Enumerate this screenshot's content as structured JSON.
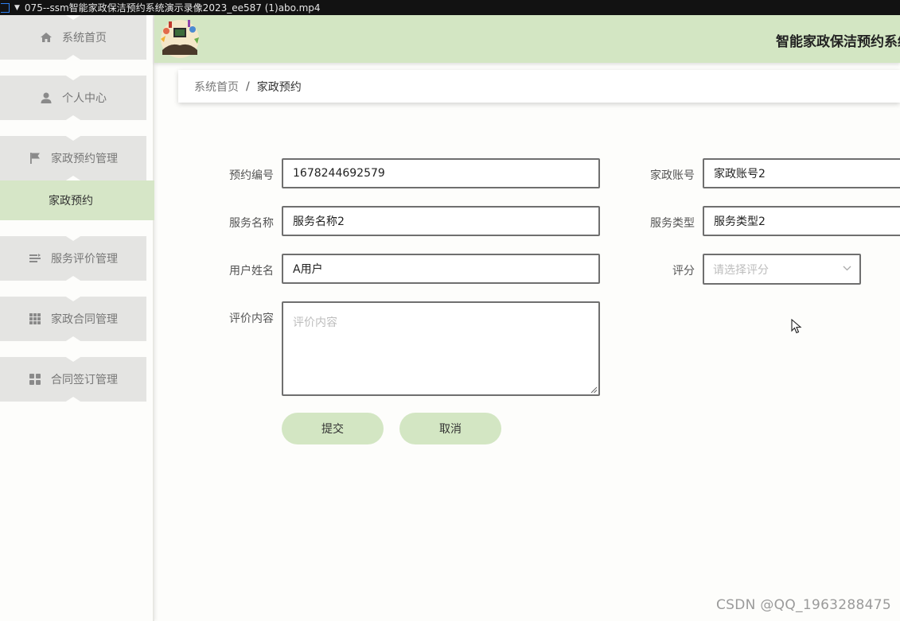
{
  "window": {
    "title": "075--ssm智能家政保洁预约系统演示录像2023_ee587 (1)abo.mp4"
  },
  "sidebar": {
    "items": [
      {
        "label": "系统首页",
        "icon": "home-icon"
      },
      {
        "label": "个人中心",
        "icon": "user-icon"
      },
      {
        "label": "家政预约管理",
        "icon": "flag-icon"
      },
      {
        "label": "服务评价管理",
        "icon": "list-icon"
      },
      {
        "label": "家政合同管理",
        "icon": "grid-icon"
      },
      {
        "label": "合同签订管理",
        "icon": "apps-icon"
      }
    ],
    "active_sub": "家政预约"
  },
  "header": {
    "title": "智能家政保洁预约系统"
  },
  "breadcrumb": {
    "home": "系统首页",
    "separator": "/",
    "current": "家政预约"
  },
  "form": {
    "booking_no_label": "预约编号",
    "booking_no_value": "1678244692579",
    "service_name_label": "服务名称",
    "service_name_value": "服务名称2",
    "user_name_label": "用户姓名",
    "user_name_value": "A用户",
    "review_label": "评价内容",
    "review_placeholder": "评价内容",
    "account_label": "家政账号",
    "account_value": "家政账号2",
    "service_type_label": "服务类型",
    "service_type_value": "服务类型2",
    "rating_label": "评分",
    "rating_placeholder": "请选择评分"
  },
  "buttons": {
    "submit": "提交",
    "cancel": "取消"
  },
  "watermark": "CSDN @QQ_1963288475",
  "colors": {
    "accent_green": "#d3e6c3",
    "menu_gray": "#e4e4e2",
    "titlebar": "#121212"
  }
}
